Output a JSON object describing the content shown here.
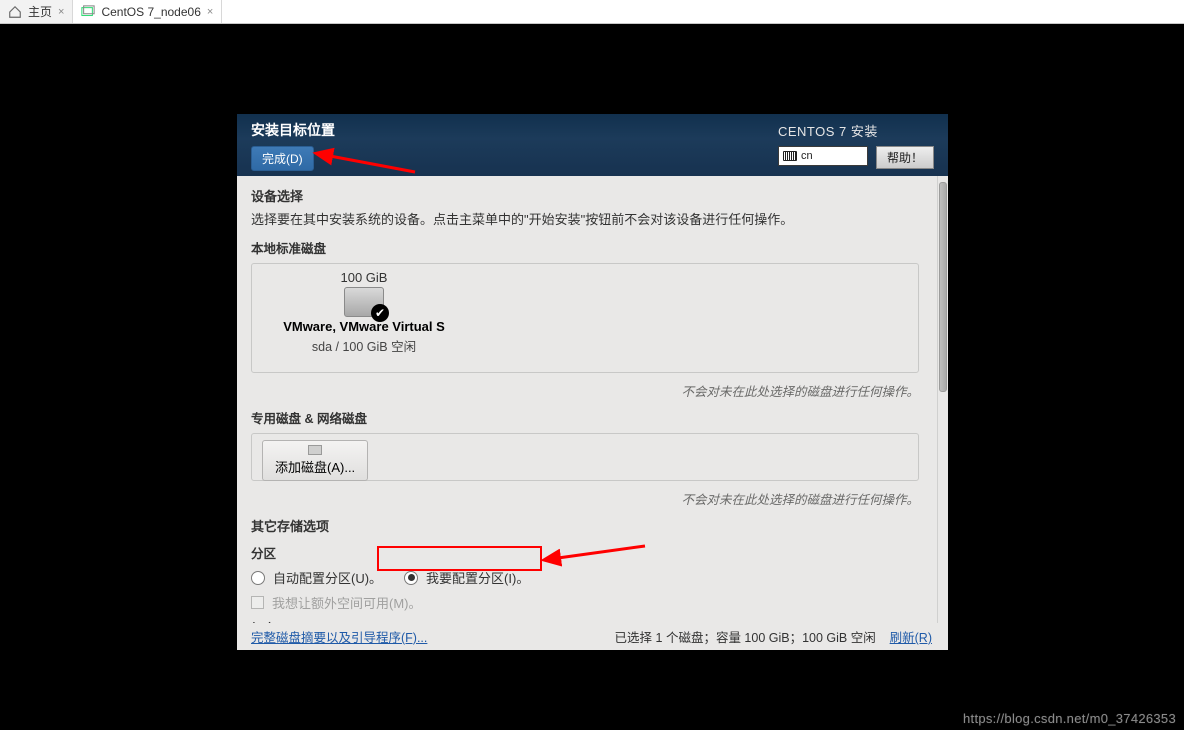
{
  "outer_tabs": {
    "home": {
      "label": "主页"
    },
    "vm": {
      "label": "CentOS 7_node06"
    }
  },
  "topbar": {
    "title": "安装目标位置",
    "done_label": "完成(D)",
    "installer_name": "CENTOS 7 安装",
    "lang_code": "cn",
    "help_label": "帮助！"
  },
  "device_selection": {
    "heading": "设备选择",
    "description": "选择要在其中安装系统的设备。点击主菜单中的\"开始安装\"按钮前不会对该设备进行任何操作。",
    "local_disks_heading": "本地标准磁盘",
    "disks": [
      {
        "size": "100 GiB",
        "name": "VMware, VMware Virtual S",
        "subline": "sda   /   100 GiB 空闲",
        "selected": true
      }
    ],
    "note": "不会对未在此处选择的磁盘进行任何操作。",
    "special_heading": "专用磁盘 & 网络磁盘",
    "add_disk_label": "添加磁盘(A)...",
    "note2": "不会对未在此处选择的磁盘进行任何操作。"
  },
  "other_storage": {
    "heading": "其它存储选项",
    "partition_label": "分区",
    "auto_partition": "自动配置分区(U)。",
    "manual_partition": "我要配置分区(I)。",
    "extra_space": "我想让额外空间可用(M)。",
    "encryption_heading": "加密"
  },
  "footer": {
    "summary_link": "完整磁盘摘要以及引导程序(F)...",
    "status": "已选择 1 个磁盘；容量 100 GiB；100 GiB 空闲",
    "refresh_label": "刷新(R)"
  },
  "watermark": "https://blog.csdn.net/m0_37426353"
}
